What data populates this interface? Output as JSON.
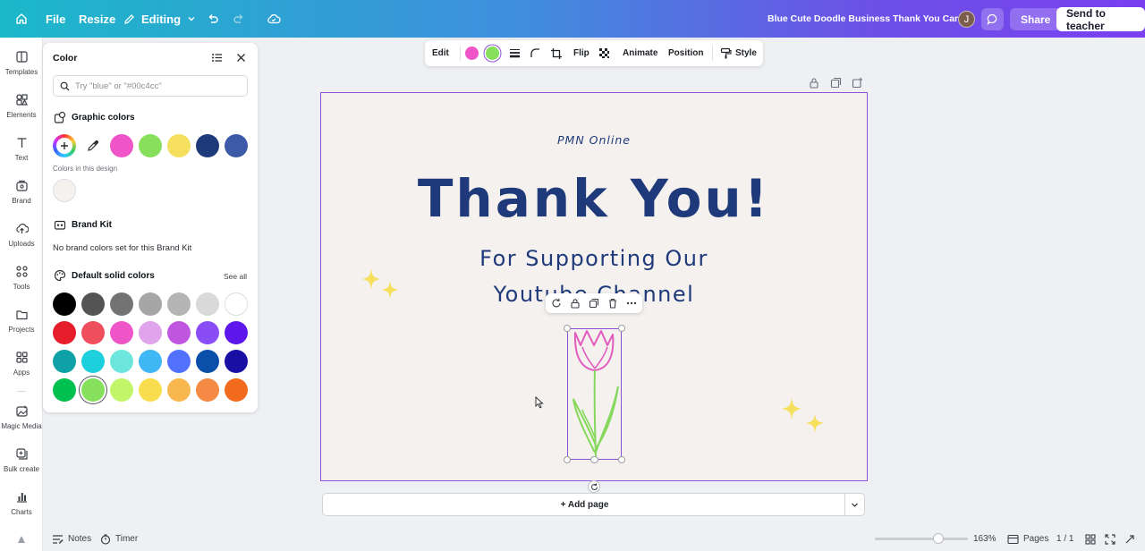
{
  "topbar": {
    "file_label": "File",
    "resize_label": "Resize",
    "editing_label": "Editing",
    "doc_title": "Blue Cute Doodle Business Thank You Card",
    "avatar_initial": "J",
    "share_label": "Share",
    "send_label": "Send to teacher"
  },
  "rail": {
    "items": [
      {
        "label": "Templates",
        "icon": "templates-icon"
      },
      {
        "label": "Elements",
        "icon": "elements-icon"
      },
      {
        "label": "Text",
        "icon": "text-icon"
      },
      {
        "label": "Brand",
        "icon": "brand-icon"
      },
      {
        "label": "Uploads",
        "icon": "uploads-icon"
      },
      {
        "label": "Tools",
        "icon": "tools-icon"
      },
      {
        "label": "Projects",
        "icon": "projects-icon"
      },
      {
        "label": "Apps",
        "icon": "apps-icon"
      },
      {
        "label": "Magic Media",
        "icon": "magic-media-icon"
      },
      {
        "label": "Bulk create",
        "icon": "bulk-create-icon"
      },
      {
        "label": "Charts",
        "icon": "charts-icon"
      }
    ]
  },
  "color_panel": {
    "title": "Color",
    "search_placeholder": "Try \"blue\" or \"#00c4cc\"",
    "graphic_colors_title": "Graphic colors",
    "graphic_colors": [
      "#ef55c7",
      "#86e05c",
      "#f6df5c",
      "#1f3a7a",
      "#3d5aa8"
    ],
    "colors_in_design_label": "Colors in this design",
    "design_colors": [
      "#f4f1ee"
    ],
    "brand_kit_title": "Brand Kit",
    "brand_kit_empty": "No brand colors set for this Brand Kit",
    "default_title": "Default solid colors",
    "see_all_label": "See all",
    "default_colors": [
      [
        "#000000",
        "#545454",
        "#737373",
        "#a6a6a6",
        "#b4b4b4",
        "#d9d9d9",
        "#ffffff"
      ],
      [
        "#e61e2b",
        "#ef4f5d",
        "#ef55c7",
        "#e0a4ec",
        "#c055e0",
        "#8a4cf5",
        "#5e17eb"
      ],
      [
        "#0ea1a8",
        "#1ed0de",
        "#6de6dd",
        "#3fb7f5",
        "#5271ff",
        "#0a4fa8",
        "#1a0fa3"
      ],
      [
        "#00c050",
        "#86e05c",
        "#c2f56a",
        "#f8de4e",
        "#f8b74f",
        "#f48a45",
        "#f26b1d"
      ]
    ],
    "selected_default": "#86e05c"
  },
  "context_toolbar": {
    "edit_label": "Edit",
    "color1": "#ef55c7",
    "color2": "#86e05c",
    "flip_label": "Flip",
    "animate_label": "Animate",
    "position_label": "Position",
    "style_label": "Style"
  },
  "canvas": {
    "brand": "PMN Online",
    "headline": "Thank You!",
    "sub_line1": "For Supporting Our",
    "sub_line2": "Youtube Channel",
    "bg": "#f4f1ee",
    "accent": "#1f3a7a"
  },
  "add_page_label": "+ Add page",
  "footer": {
    "notes_label": "Notes",
    "timer_label": "Timer",
    "zoom_fraction": 0.68,
    "zoom_label": "163%",
    "pages_label": "Pages",
    "page_count": "1 / 1"
  }
}
